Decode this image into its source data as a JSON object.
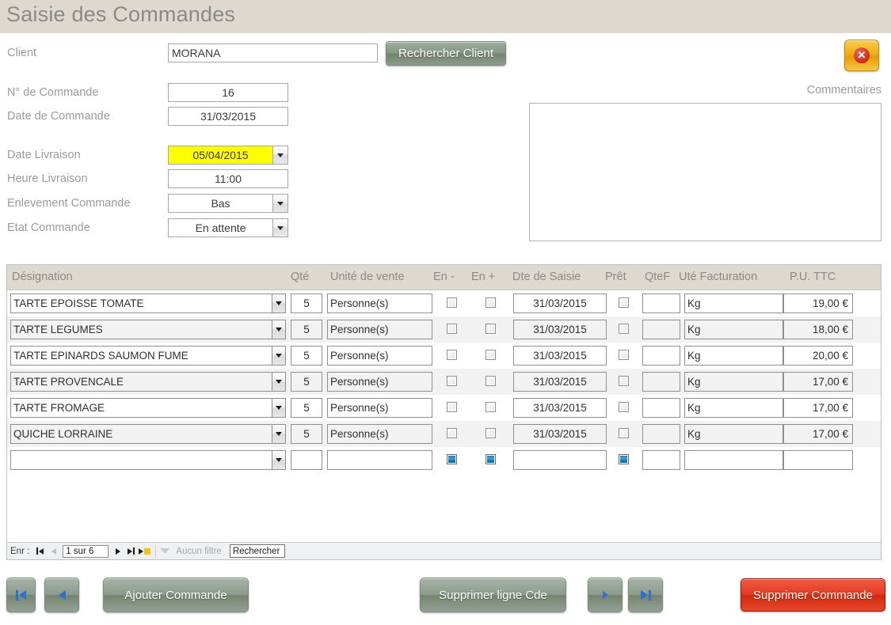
{
  "window": {
    "title": "Saisie des Commandes"
  },
  "close_button": {
    "icon": "close-x-icon",
    "glyph": "✕"
  },
  "form": {
    "client": {
      "label": "Client",
      "value": "MORANA"
    },
    "search_client_button": "Rechercher Client",
    "order_number": {
      "label": "N° de Commande",
      "value": "16"
    },
    "order_date": {
      "label": "Date de Commande",
      "value": "31/03/2015"
    },
    "delivery_date": {
      "label": "Date Livraison",
      "value": "05/04/2015",
      "highlight_color": "#ffff00"
    },
    "delivery_time": {
      "label": "Heure Livraison",
      "value": "11:00"
    },
    "order_pickup": {
      "label": "Enlevement Commande",
      "value": "Bas"
    },
    "order_state": {
      "label": "Etat Commande",
      "value": "En attente"
    },
    "comments": {
      "label": "Commentaires",
      "value": ""
    }
  },
  "grid": {
    "columns": [
      "Désignation",
      "Qté",
      "Unité de vente",
      "En -",
      "En +",
      "Dte de Saisie",
      "Prêt",
      "QteF",
      "Uté Facturation",
      "P.U. TTC"
    ],
    "rows": [
      {
        "designation": "TARTE EPOISSE TOMATE",
        "qte": "5",
        "unite_vente": "Personne(s)",
        "en_moins": false,
        "en_plus": false,
        "dte_saisie": "31/03/2015",
        "pret": false,
        "qtef": "",
        "ute_facturation": "Kg",
        "pu_ttc": "19,00 €"
      },
      {
        "designation": "TARTE LEGUMES",
        "qte": "5",
        "unite_vente": "Personne(s)",
        "en_moins": false,
        "en_plus": false,
        "dte_saisie": "31/03/2015",
        "pret": false,
        "qtef": "",
        "ute_facturation": "Kg",
        "pu_ttc": "18,00 €"
      },
      {
        "designation": "TARTE EPINARDS SAUMON FUME",
        "qte": "5",
        "unite_vente": "Personne(s)",
        "en_moins": false,
        "en_plus": false,
        "dte_saisie": "31/03/2015",
        "pret": false,
        "qtef": "",
        "ute_facturation": "Kg",
        "pu_ttc": "20,00 €"
      },
      {
        "designation": "TARTE PROVENCALE",
        "qte": "5",
        "unite_vente": "Personne(s)",
        "en_moins": false,
        "en_plus": false,
        "dte_saisie": "31/03/2015",
        "pret": false,
        "qtef": "",
        "ute_facturation": "Kg",
        "pu_ttc": "17,00 €"
      },
      {
        "designation": "TARTE FROMAGE",
        "qte": "5",
        "unite_vente": "Personne(s)",
        "en_moins": false,
        "en_plus": false,
        "dte_saisie": "31/03/2015",
        "pret": false,
        "qtef": "",
        "ute_facturation": "Kg",
        "pu_ttc": "17,00 €"
      },
      {
        "designation": "QUICHE LORRAINE",
        "qte": "5",
        "unite_vente": "Personne(s)",
        "en_moins": false,
        "en_plus": false,
        "dte_saisie": "31/03/2015",
        "pret": false,
        "qtef": "",
        "ute_facturation": "Kg",
        "pu_ttc": "17,00 €"
      },
      {
        "designation": "",
        "qte": "",
        "unite_vente": "",
        "en_moins": true,
        "en_plus": true,
        "dte_saisie": "",
        "pret": true,
        "qtef": "",
        "ute_facturation": "",
        "pu_ttc": ""
      }
    ]
  },
  "record_nav": {
    "label": "Enr :",
    "position": "1 sur 6",
    "filter_label": "Aucun filtre",
    "search_value": "Rechercher",
    "first_icon": "first-record-icon",
    "prev_icon": "previous-record-icon",
    "next_icon": "next-record-icon",
    "last_icon": "last-record-icon",
    "new_icon": "new-record-icon",
    "filter_icon": "filter-funnel-icon"
  },
  "footer": {
    "first_button": "first-order-icon",
    "prev_button": "previous-order-icon",
    "add_order": "Ajouter Commande",
    "delete_line": "Supprimer ligne Cde",
    "next_button": "next-order-icon",
    "last_button": "last-order-icon",
    "delete_order": "Supprimer Commande"
  }
}
